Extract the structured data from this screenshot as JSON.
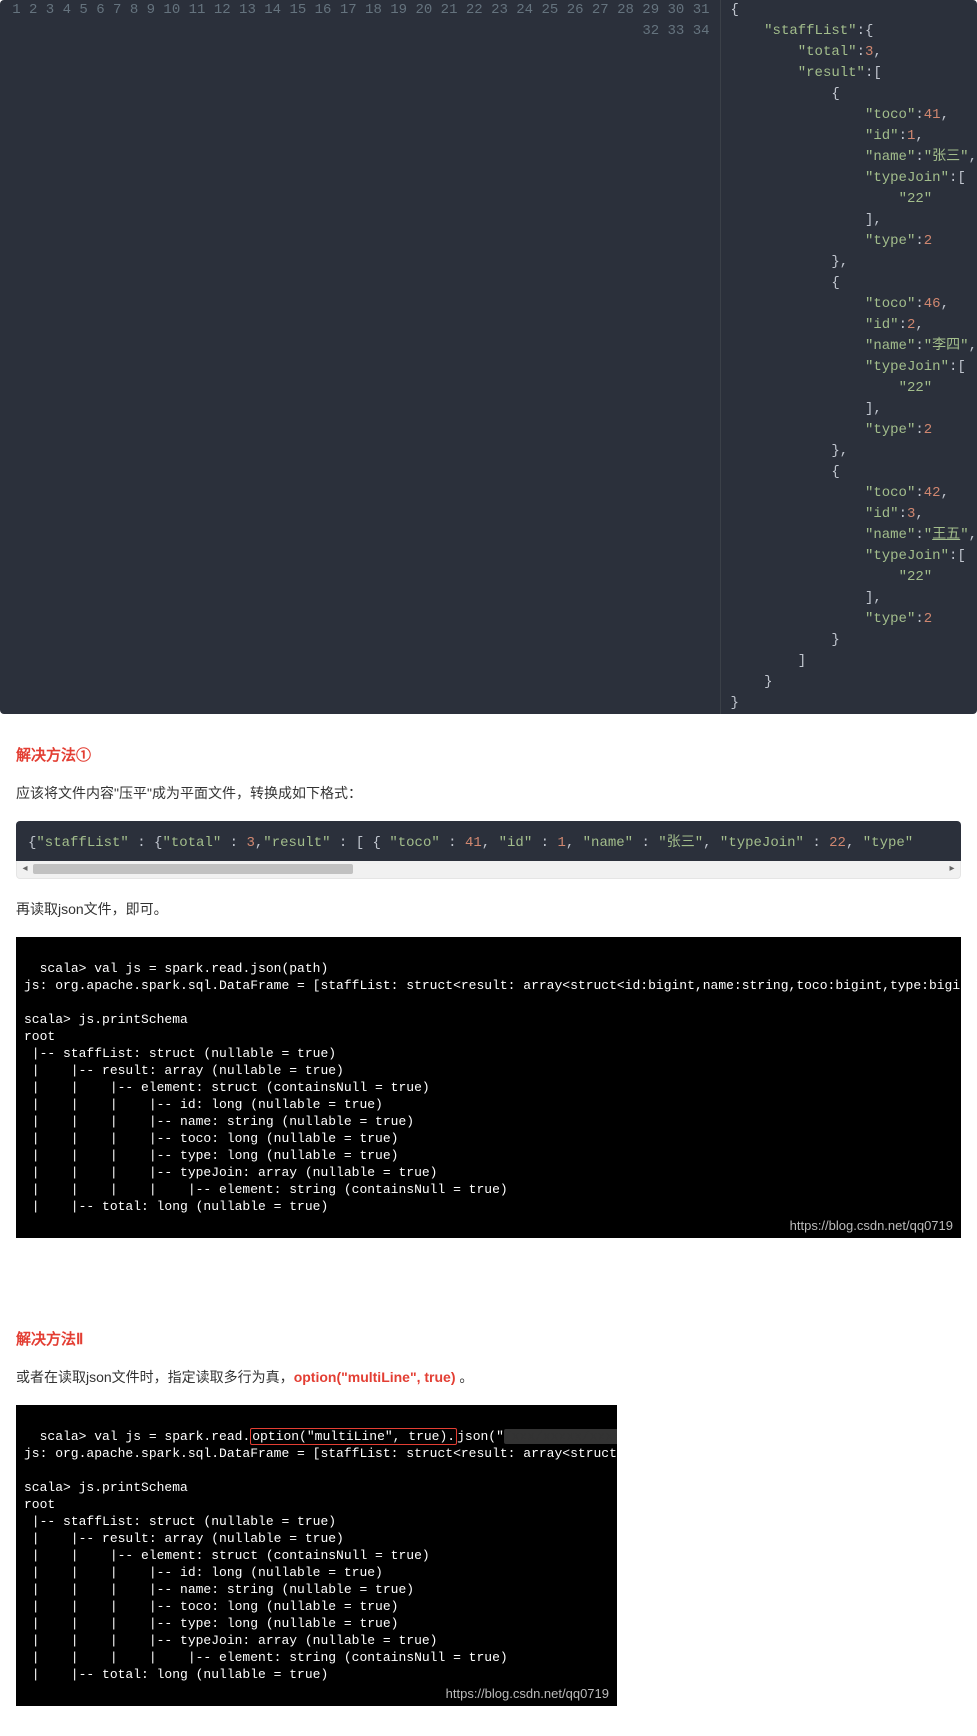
{
  "code1": {
    "lines": [
      {
        "n": "1",
        "html": "<span class='tok-punct'>{</span>"
      },
      {
        "n": "2",
        "html": "    <span class='tok-key'>\"staffList\"</span><span class='tok-punct'>:{</span>"
      },
      {
        "n": "3",
        "html": "        <span class='tok-key'>\"total\"</span><span class='tok-punct'>:</span><span class='tok-num'>3</span><span class='tok-punct'>,</span>"
      },
      {
        "n": "4",
        "html": "        <span class='tok-key'>\"result\"</span><span class='tok-punct'>:[</span>"
      },
      {
        "n": "5",
        "html": "            <span class='tok-punct'>{</span>"
      },
      {
        "n": "6",
        "html": "                <span class='tok-key'>\"toco\"</span><span class='tok-punct'>:</span><span class='tok-num'>41</span><span class='tok-punct'>,</span>"
      },
      {
        "n": "7",
        "html": "                <span class='tok-key'>\"id\"</span><span class='tok-punct'>:</span><span class='tok-num'>1</span><span class='tok-punct'>,</span>"
      },
      {
        "n": "8",
        "html": "                <span class='tok-key'>\"name\"</span><span class='tok-punct'>:</span><span class='tok-str'>\"张三\"</span><span class='tok-punct'>,</span>"
      },
      {
        "n": "9",
        "html": "                <span class='tok-key'>\"typeJoin\"</span><span class='tok-punct'>:[</span>"
      },
      {
        "n": "10",
        "html": "                    <span class='tok-str'>\"22\"</span>"
      },
      {
        "n": "11",
        "html": "                <span class='tok-punct'>],</span>"
      },
      {
        "n": "12",
        "html": "                <span class='tok-key'>\"type\"</span><span class='tok-punct'>:</span><span class='tok-num'>2</span>"
      },
      {
        "n": "13",
        "html": "            <span class='tok-punct'>},</span>"
      },
      {
        "n": "14",
        "html": "            <span class='tok-punct'>{</span>"
      },
      {
        "n": "15",
        "html": "                <span class='tok-key'>\"toco\"</span><span class='tok-punct'>:</span><span class='tok-num'>46</span><span class='tok-punct'>,</span>"
      },
      {
        "n": "16",
        "html": "                <span class='tok-key'>\"id\"</span><span class='tok-punct'>:</span><span class='tok-num'>2</span><span class='tok-punct'>,</span>"
      },
      {
        "n": "17",
        "html": "                <span class='tok-key'>\"name\"</span><span class='tok-punct'>:</span><span class='tok-str'>\"李四\"</span><span class='tok-punct'>,</span>"
      },
      {
        "n": "18",
        "html": "                <span class='tok-key'>\"typeJoin\"</span><span class='tok-punct'>:[</span>"
      },
      {
        "n": "19",
        "html": "                    <span class='tok-str'>\"22\"</span>"
      },
      {
        "n": "20",
        "html": "                <span class='tok-punct'>],</span>"
      },
      {
        "n": "21",
        "html": "                <span class='tok-key'>\"type\"</span><span class='tok-punct'>:</span><span class='tok-num'>2</span>"
      },
      {
        "n": "22",
        "html": "            <span class='tok-punct'>},</span>"
      },
      {
        "n": "23",
        "html": "            <span class='tok-punct'>{</span>"
      },
      {
        "n": "24",
        "html": "                <span class='tok-key'>\"toco\"</span><span class='tok-punct'>:</span><span class='tok-num'>42</span><span class='tok-punct'>,</span>"
      },
      {
        "n": "25",
        "html": "                <span class='tok-key'>\"id\"</span><span class='tok-punct'>:</span><span class='tok-num'>3</span><span class='tok-punct'>,</span>"
      },
      {
        "n": "26",
        "html": "                <span class='tok-key'>\"name\"</span><span class='tok-punct'>:</span><span class='tok-str'>\"<span class='tok-underline'>王五</span>\"</span><span class='tok-punct'>,</span>"
      },
      {
        "n": "27",
        "html": "                <span class='tok-key'>\"typeJoin\"</span><span class='tok-punct'>:[</span>"
      },
      {
        "n": "28",
        "html": "                    <span class='tok-str'>\"22\"</span>"
      },
      {
        "n": "29",
        "html": "                <span class='tok-punct'>],</span>"
      },
      {
        "n": "30",
        "html": "                <span class='tok-key'>\"type\"</span><span class='tok-punct'>:</span><span class='tok-num'>2</span>"
      },
      {
        "n": "31",
        "html": "            <span class='tok-punct'>}</span>"
      },
      {
        "n": "32",
        "html": "        <span class='tok-punct'>]</span>"
      },
      {
        "n": "33",
        "html": "    <span class='tok-punct'>}</span>"
      },
      {
        "n": "34",
        "html": "<span class='tok-punct'>}</span>"
      }
    ]
  },
  "section1": {
    "heading": "解决方法①",
    "para": "应该将文件内容\"压平\"成为平面文件，转换成如下格式：",
    "flat_html": "<span class='tok-punct'>{</span><span class='tok-key'>\"staffList\"</span> <span class='tok-punct'>: {</span><span class='tok-key'>\"total\"</span> <span class='tok-punct'>:</span> <span class='tok-num'>3</span><span class='tok-punct'>,</span><span class='tok-key'>\"result\"</span> <span class='tok-punct'>: [ {</span>  <span class='tok-key'>\"toco\"</span> <span class='tok-punct'>:</span> <span class='tok-num'>41</span><span class='tok-punct'>,</span>  <span class='tok-key'>\"id\"</span> <span class='tok-punct'>:</span> <span class='tok-num'>1</span><span class='tok-punct'>,</span>  <span class='tok-key'>\"name\"</span> <span class='tok-punct'>:</span> <span class='tok-str'>\"张三\"</span><span class='tok-punct'>,</span>  <span class='tok-key'>\"typeJoin\"</span> <span class='tok-punct'>:</span> <span class='tok-num'>22</span><span class='tok-punct'>,</span>  <span class='tok-key'>\"type\"</span>",
    "para2": "再读取json文件，即可。",
    "terminal": "scala> val js = spark.read.json(path)\njs: org.apache.spark.sql.DataFrame = [staffList: struct<result: array<struct<id:bigint,name:string,toco:bigint,type:bigint,typeJoin:array<string>>>, total: bigint>]\n\nscala> js.printSchema\nroot\n |-- staffList: struct (nullable = true)\n |    |-- result: array (nullable = true)\n |    |    |-- element: struct (containsNull = true)\n |    |    |    |-- id: long (nullable = true)\n |    |    |    |-- name: string (nullable = true)\n |    |    |    |-- toco: long (nullable = true)\n |    |    |    |-- type: long (nullable = true)\n |    |    |    |-- typeJoin: array (nullable = true)\n |    |    |    |    |-- element: string (containsNull = true)\n |    |-- total: long (nullable = true)",
    "watermark": "https://blog.csdn.net/qq0719"
  },
  "section2": {
    "heading": "解决方法Ⅱ",
    "para_prefix": "或者在读取json文件时，指定读取多行为真，",
    "para_red": "option(\"multiLine\", true)",
    "para_suffix": " 。",
    "terminal_html": "scala> val js = spark.read.<span class='redbox'>option(\"multiLine\", true).</span>json(\"<span class='smudge'>/xxx/xxxxx/xxxxxx</span>\")\njs: org.apache.spark.sql.DataFrame = [staffList: struct&lt;result: array&lt;struct&lt;id:l\n\nscala> js.printSchema\nroot\n |-- staffList: struct (nullable = true)\n |    |-- result: array (nullable = true)\n |    |    |-- element: struct (containsNull = true)\n |    |    |    |-- id: long (nullable = true)\n |    |    |    |-- name: string (nullable = true)\n |    |    |    |-- toco: long (nullable = true)\n |    |    |    |-- type: long (nullable = true)\n |    |    |    |-- typeJoin: array (nullable = true)\n |    |    |    |    |-- element: string (containsNull = true)\n |    |-- total: long (nullable = true)",
    "watermark": "https://blog.csdn.net/qq0719"
  }
}
